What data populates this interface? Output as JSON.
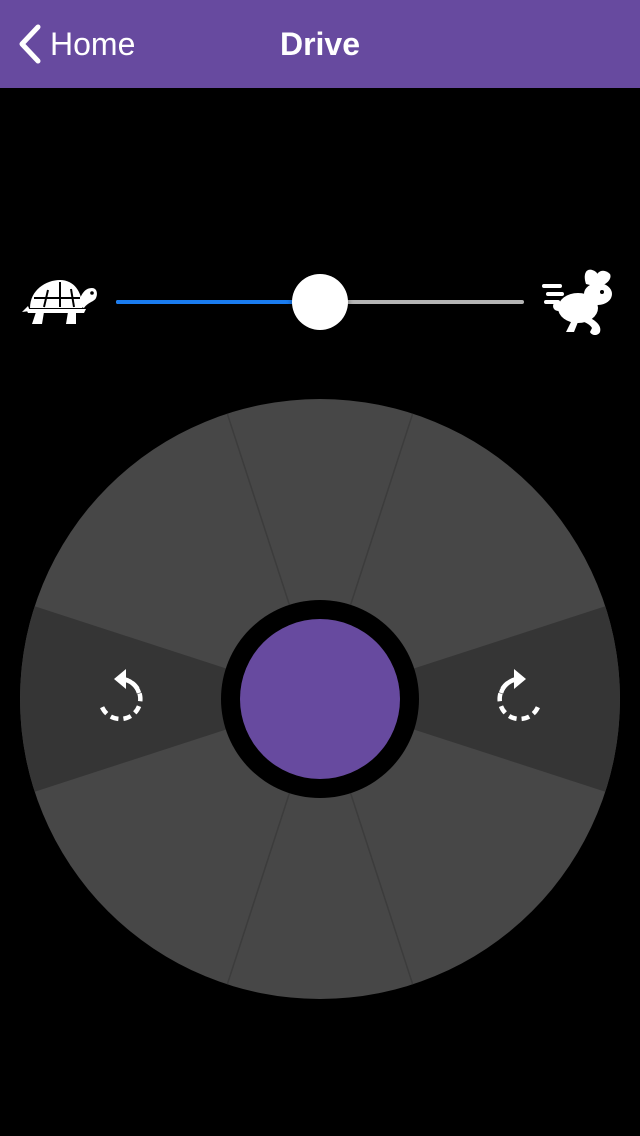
{
  "nav": {
    "back_label": "Home",
    "title": "Drive"
  },
  "speed": {
    "slow_icon": "turtle-icon",
    "fast_icon": "rabbit-icon",
    "value": 0.5
  },
  "joystick": {
    "rotate_left_icon": "rotate-counterclockwise-icon",
    "rotate_right_icon": "rotate-clockwise-icon",
    "center_color": "#674a9f"
  },
  "colors": {
    "accent": "#674a9f",
    "slider_active": "#1a7cf0",
    "slider_inactive": "#b5b5b5",
    "wheel": "#474747",
    "wheel_side": "#353535"
  }
}
